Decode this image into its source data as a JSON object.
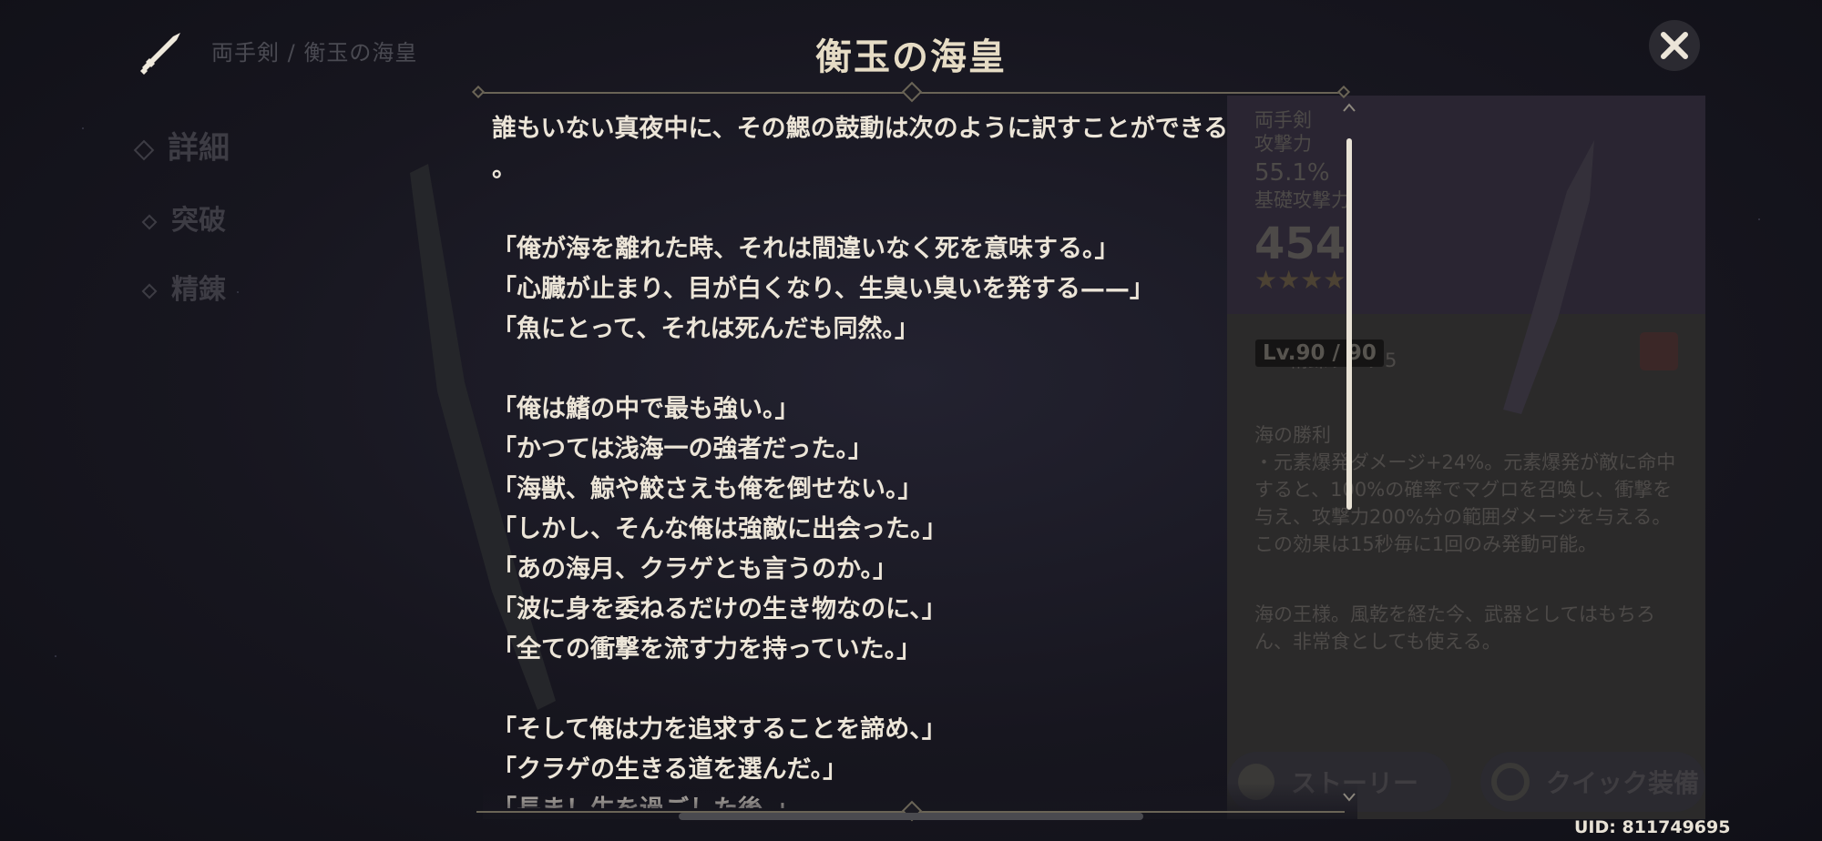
{
  "header": {
    "title": "衡玉の海皇",
    "breadcrumb": "両手剣 / 衡玉の海皇",
    "weapon_type_icon": "claymore-icon",
    "close_icon": "close-icon"
  },
  "side_nav": [
    {
      "label": "詳細"
    },
    {
      "label": "突破"
    },
    {
      "label": "精錬"
    }
  ],
  "info_panel": {
    "weapon_type": "両手剣",
    "substat_label": "攻撃力",
    "substat_value": "55.1%",
    "base_atk_label": "基礎攻撃力",
    "base_atk_value": "454",
    "stars": "★★★★",
    "level": "Lv.90 / 90",
    "refinement": "精錬ランク5",
    "passive_name": "海の勝利",
    "passive_text": "・元素爆発ダメージ+24%。元素爆発が敵に命中すると、100%の確率でマグロを召喚し、衝撃を与え、攻撃力200%分の範囲ダメージを与える。この効果は15秒毎に1回のみ発動可能。",
    "description": "海の王様。風乾を経た今、武器としてはもちろん、非常食としても使える。",
    "colors": {
      "highlight": "#3a6ea8"
    }
  },
  "story": {
    "lines": [
      "誰もいない真夜中に、その鰓の鼓動は次のように訳すことができる",
      "。",
      "",
      "「俺が海を離れた時、それは間違いなく死を意味する。」",
      "「心臓が止まり、目が白くなり、生臭い臭いを発する——」",
      "「魚にとって、それは死んだも同然。」",
      "",
      "「俺は鰭の中で最も強い。」",
      "「かつては浅海一の強者だった。」",
      "「海獣、鯨や鮫さえも俺を倒せない。」",
      "「しかし、そんな俺は強敵に出会った。」",
      "「あの海月、クラゲとも言うのか。」",
      "「波に身を委ねるだけの生き物なのに、」",
      "「全ての衝撃を流す力を持っていた。」",
      "",
      "「そして俺は力を追求することを諦め、」",
      "「クラゲの生きる道を選んだ。」",
      "「長ま！生を過ごした後、」"
    ]
  },
  "buttons": {
    "story": "ストーリー",
    "quick_equip": "クイック装備"
  },
  "uid": "UID: 811749695"
}
